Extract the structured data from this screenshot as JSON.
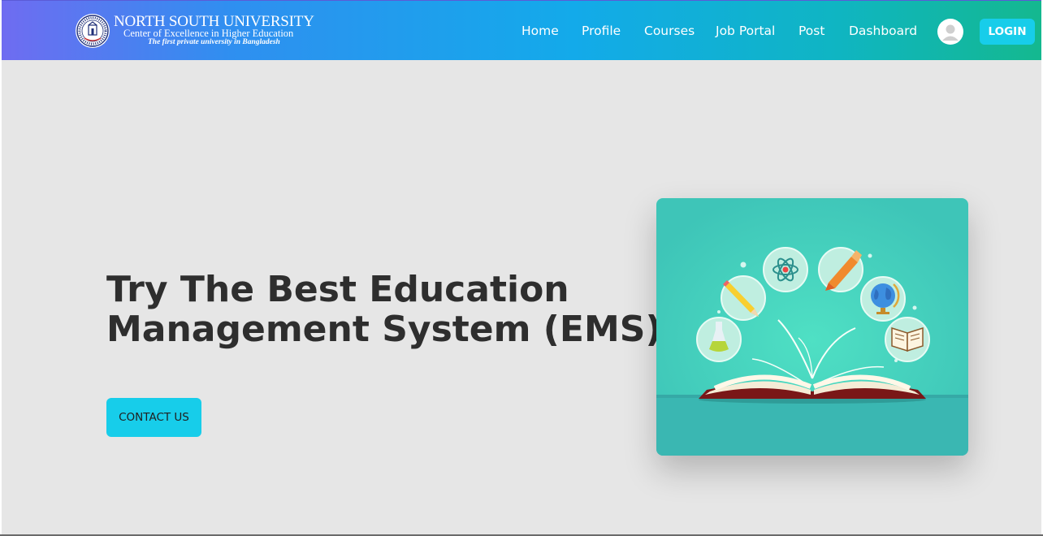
{
  "brand": {
    "title": "NORTH SOUTH UNIVERSITY",
    "subtitle": "Center of Excellence in Higher Education",
    "tagline": "The first private university in Bangladesh",
    "seal_text": "NORTH SOUTH UNIVERSITY"
  },
  "nav": {
    "links": [
      {
        "label": "Home"
      },
      {
        "label": "Profile"
      },
      {
        "label": "Courses"
      },
      {
        "label": "Job Portal"
      },
      {
        "label": "Post"
      },
      {
        "label": "Dashboard"
      }
    ],
    "avatar_icon": "user-avatar-icon",
    "login_label": "LOGIN"
  },
  "hero": {
    "heading_line1": "Try The Best Education",
    "heading_line2": "Management System (EMS)",
    "cta_label": "CONTACT US",
    "illustration_icons": [
      "flask-icon",
      "pencil-icon",
      "atom-icon",
      "crayon-icon",
      "globe-icon",
      "book-icon",
      "open-book-icon"
    ]
  },
  "colors": {
    "nav_gradient_start": "#6f6cf1",
    "nav_gradient_end": "#14b88f",
    "accent": "#17cdea",
    "heading": "#2e2e2e",
    "page_bg": "#e6e6e6",
    "illustration_bg": "#46cdb8"
  }
}
